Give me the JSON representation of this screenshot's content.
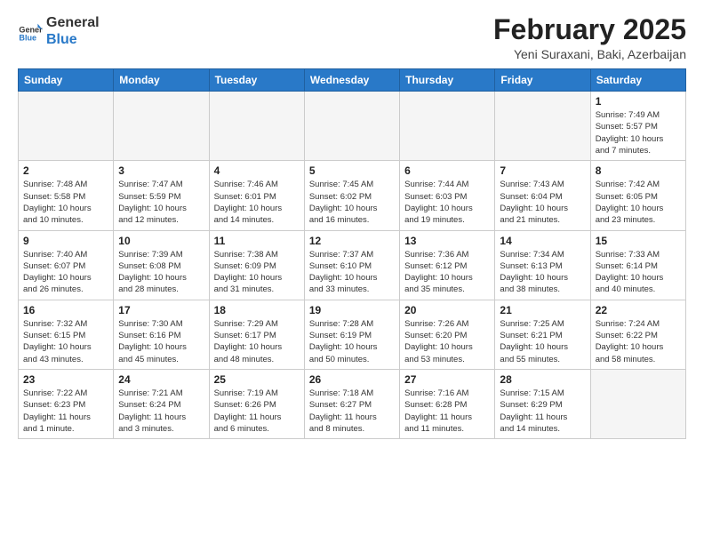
{
  "header": {
    "logo_general": "General",
    "logo_blue": "Blue",
    "month_year": "February 2025",
    "location": "Yeni Suraxani, Baki, Azerbaijan"
  },
  "weekdays": [
    "Sunday",
    "Monday",
    "Tuesday",
    "Wednesday",
    "Thursday",
    "Friday",
    "Saturday"
  ],
  "weeks": [
    [
      {
        "day": "",
        "info": ""
      },
      {
        "day": "",
        "info": ""
      },
      {
        "day": "",
        "info": ""
      },
      {
        "day": "",
        "info": ""
      },
      {
        "day": "",
        "info": ""
      },
      {
        "day": "",
        "info": ""
      },
      {
        "day": "1",
        "info": "Sunrise: 7:49 AM\nSunset: 5:57 PM\nDaylight: 10 hours\nand 7 minutes."
      }
    ],
    [
      {
        "day": "2",
        "info": "Sunrise: 7:48 AM\nSunset: 5:58 PM\nDaylight: 10 hours\nand 10 minutes."
      },
      {
        "day": "3",
        "info": "Sunrise: 7:47 AM\nSunset: 5:59 PM\nDaylight: 10 hours\nand 12 minutes."
      },
      {
        "day": "4",
        "info": "Sunrise: 7:46 AM\nSunset: 6:01 PM\nDaylight: 10 hours\nand 14 minutes."
      },
      {
        "day": "5",
        "info": "Sunrise: 7:45 AM\nSunset: 6:02 PM\nDaylight: 10 hours\nand 16 minutes."
      },
      {
        "day": "6",
        "info": "Sunrise: 7:44 AM\nSunset: 6:03 PM\nDaylight: 10 hours\nand 19 minutes."
      },
      {
        "day": "7",
        "info": "Sunrise: 7:43 AM\nSunset: 6:04 PM\nDaylight: 10 hours\nand 21 minutes."
      },
      {
        "day": "8",
        "info": "Sunrise: 7:42 AM\nSunset: 6:05 PM\nDaylight: 10 hours\nand 23 minutes."
      }
    ],
    [
      {
        "day": "9",
        "info": "Sunrise: 7:40 AM\nSunset: 6:07 PM\nDaylight: 10 hours\nand 26 minutes."
      },
      {
        "day": "10",
        "info": "Sunrise: 7:39 AM\nSunset: 6:08 PM\nDaylight: 10 hours\nand 28 minutes."
      },
      {
        "day": "11",
        "info": "Sunrise: 7:38 AM\nSunset: 6:09 PM\nDaylight: 10 hours\nand 31 minutes."
      },
      {
        "day": "12",
        "info": "Sunrise: 7:37 AM\nSunset: 6:10 PM\nDaylight: 10 hours\nand 33 minutes."
      },
      {
        "day": "13",
        "info": "Sunrise: 7:36 AM\nSunset: 6:12 PM\nDaylight: 10 hours\nand 35 minutes."
      },
      {
        "day": "14",
        "info": "Sunrise: 7:34 AM\nSunset: 6:13 PM\nDaylight: 10 hours\nand 38 minutes."
      },
      {
        "day": "15",
        "info": "Sunrise: 7:33 AM\nSunset: 6:14 PM\nDaylight: 10 hours\nand 40 minutes."
      }
    ],
    [
      {
        "day": "16",
        "info": "Sunrise: 7:32 AM\nSunset: 6:15 PM\nDaylight: 10 hours\nand 43 minutes."
      },
      {
        "day": "17",
        "info": "Sunrise: 7:30 AM\nSunset: 6:16 PM\nDaylight: 10 hours\nand 45 minutes."
      },
      {
        "day": "18",
        "info": "Sunrise: 7:29 AM\nSunset: 6:17 PM\nDaylight: 10 hours\nand 48 minutes."
      },
      {
        "day": "19",
        "info": "Sunrise: 7:28 AM\nSunset: 6:19 PM\nDaylight: 10 hours\nand 50 minutes."
      },
      {
        "day": "20",
        "info": "Sunrise: 7:26 AM\nSunset: 6:20 PM\nDaylight: 10 hours\nand 53 minutes."
      },
      {
        "day": "21",
        "info": "Sunrise: 7:25 AM\nSunset: 6:21 PM\nDaylight: 10 hours\nand 55 minutes."
      },
      {
        "day": "22",
        "info": "Sunrise: 7:24 AM\nSunset: 6:22 PM\nDaylight: 10 hours\nand 58 minutes."
      }
    ],
    [
      {
        "day": "23",
        "info": "Sunrise: 7:22 AM\nSunset: 6:23 PM\nDaylight: 11 hours\nand 1 minute."
      },
      {
        "day": "24",
        "info": "Sunrise: 7:21 AM\nSunset: 6:24 PM\nDaylight: 11 hours\nand 3 minutes."
      },
      {
        "day": "25",
        "info": "Sunrise: 7:19 AM\nSunset: 6:26 PM\nDaylight: 11 hours\nand 6 minutes."
      },
      {
        "day": "26",
        "info": "Sunrise: 7:18 AM\nSunset: 6:27 PM\nDaylight: 11 hours\nand 8 minutes."
      },
      {
        "day": "27",
        "info": "Sunrise: 7:16 AM\nSunset: 6:28 PM\nDaylight: 11 hours\nand 11 minutes."
      },
      {
        "day": "28",
        "info": "Sunrise: 7:15 AM\nSunset: 6:29 PM\nDaylight: 11 hours\nand 14 minutes."
      },
      {
        "day": "",
        "info": ""
      }
    ]
  ]
}
